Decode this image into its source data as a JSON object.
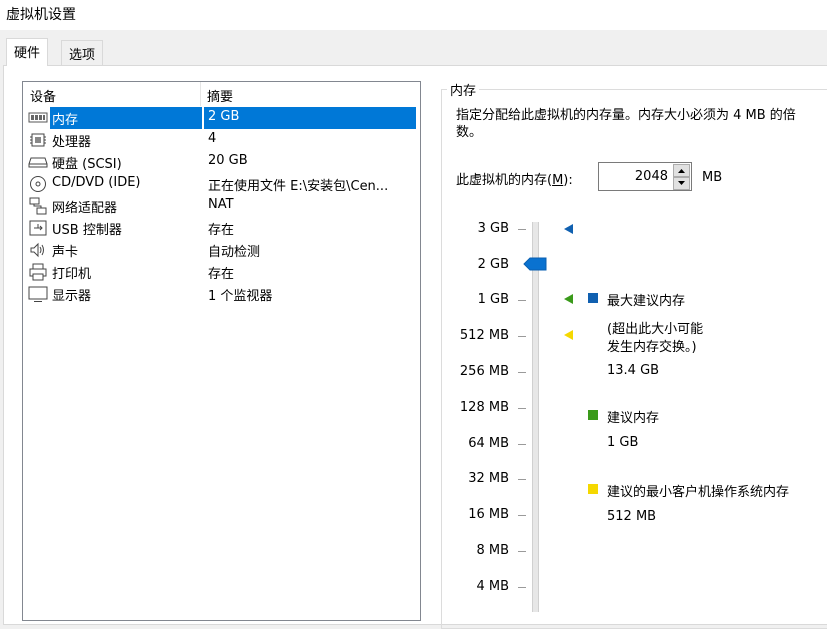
{
  "window": {
    "title": "虚拟机设置"
  },
  "tabs": [
    {
      "label": "硬件",
      "active": true
    },
    {
      "label": "选项",
      "active": false
    }
  ],
  "device_list": {
    "columns": {
      "device": "设备",
      "summary": "摘要"
    },
    "rows": [
      {
        "icon": "memory-icon",
        "name": "内存",
        "summary": "2 GB",
        "selected": true
      },
      {
        "icon": "processor-icon",
        "name": "处理器",
        "summary": "4",
        "selected": false
      },
      {
        "icon": "hard-disk-icon",
        "name": "硬盘 (SCSI)",
        "summary": "20 GB",
        "selected": false
      },
      {
        "icon": "cd-dvd-icon",
        "name": "CD/DVD (IDE)",
        "summary": "正在使用文件 E:\\安装包\\Cen...",
        "selected": false
      },
      {
        "icon": "network-adapter-icon",
        "name": "网络适配器",
        "summary": "NAT",
        "selected": false
      },
      {
        "icon": "usb-icon",
        "name": "USB 控制器",
        "summary": "存在",
        "selected": false
      },
      {
        "icon": "sound-card-icon",
        "name": "声卡",
        "summary": "自动检测",
        "selected": false
      },
      {
        "icon": "printer-icon",
        "name": "打印机",
        "summary": "存在",
        "selected": false
      },
      {
        "icon": "display-icon",
        "name": "显示器",
        "summary": "1 个监视器",
        "selected": false
      }
    ]
  },
  "memory": {
    "group_title": "内存",
    "description": "指定分配给此虚拟机的内存量。内存大小必须为 4 MB 的倍数。",
    "input_label": "此虚拟机的内存(M):",
    "input_label_mnemonic": "M",
    "value": "2048",
    "unit": "MB",
    "scale_labels": [
      "3 GB",
      "2 GB",
      "1 GB",
      "512 MB",
      "256 MB",
      "128 MB",
      "64 MB",
      "32 MB",
      "16 MB",
      "8 MB",
      "4 MB"
    ],
    "slider_value": "2 GB",
    "legend": {
      "max": {
        "label": "最大建议内存",
        "note_line1": "(超出此大小可能",
        "note_line2": "发生内存交换。)",
        "value": "13.4 GB",
        "color": "#1060b0"
      },
      "recommended": {
        "label": "建议内存",
        "value": "1 GB",
        "color": "#3a9a1a"
      },
      "min_guest": {
        "label": "建议的最小客户机操作系统内存",
        "value": "512 MB",
        "color": "#f5d800"
      }
    },
    "slider_thumb_color": "#0a72d0"
  }
}
